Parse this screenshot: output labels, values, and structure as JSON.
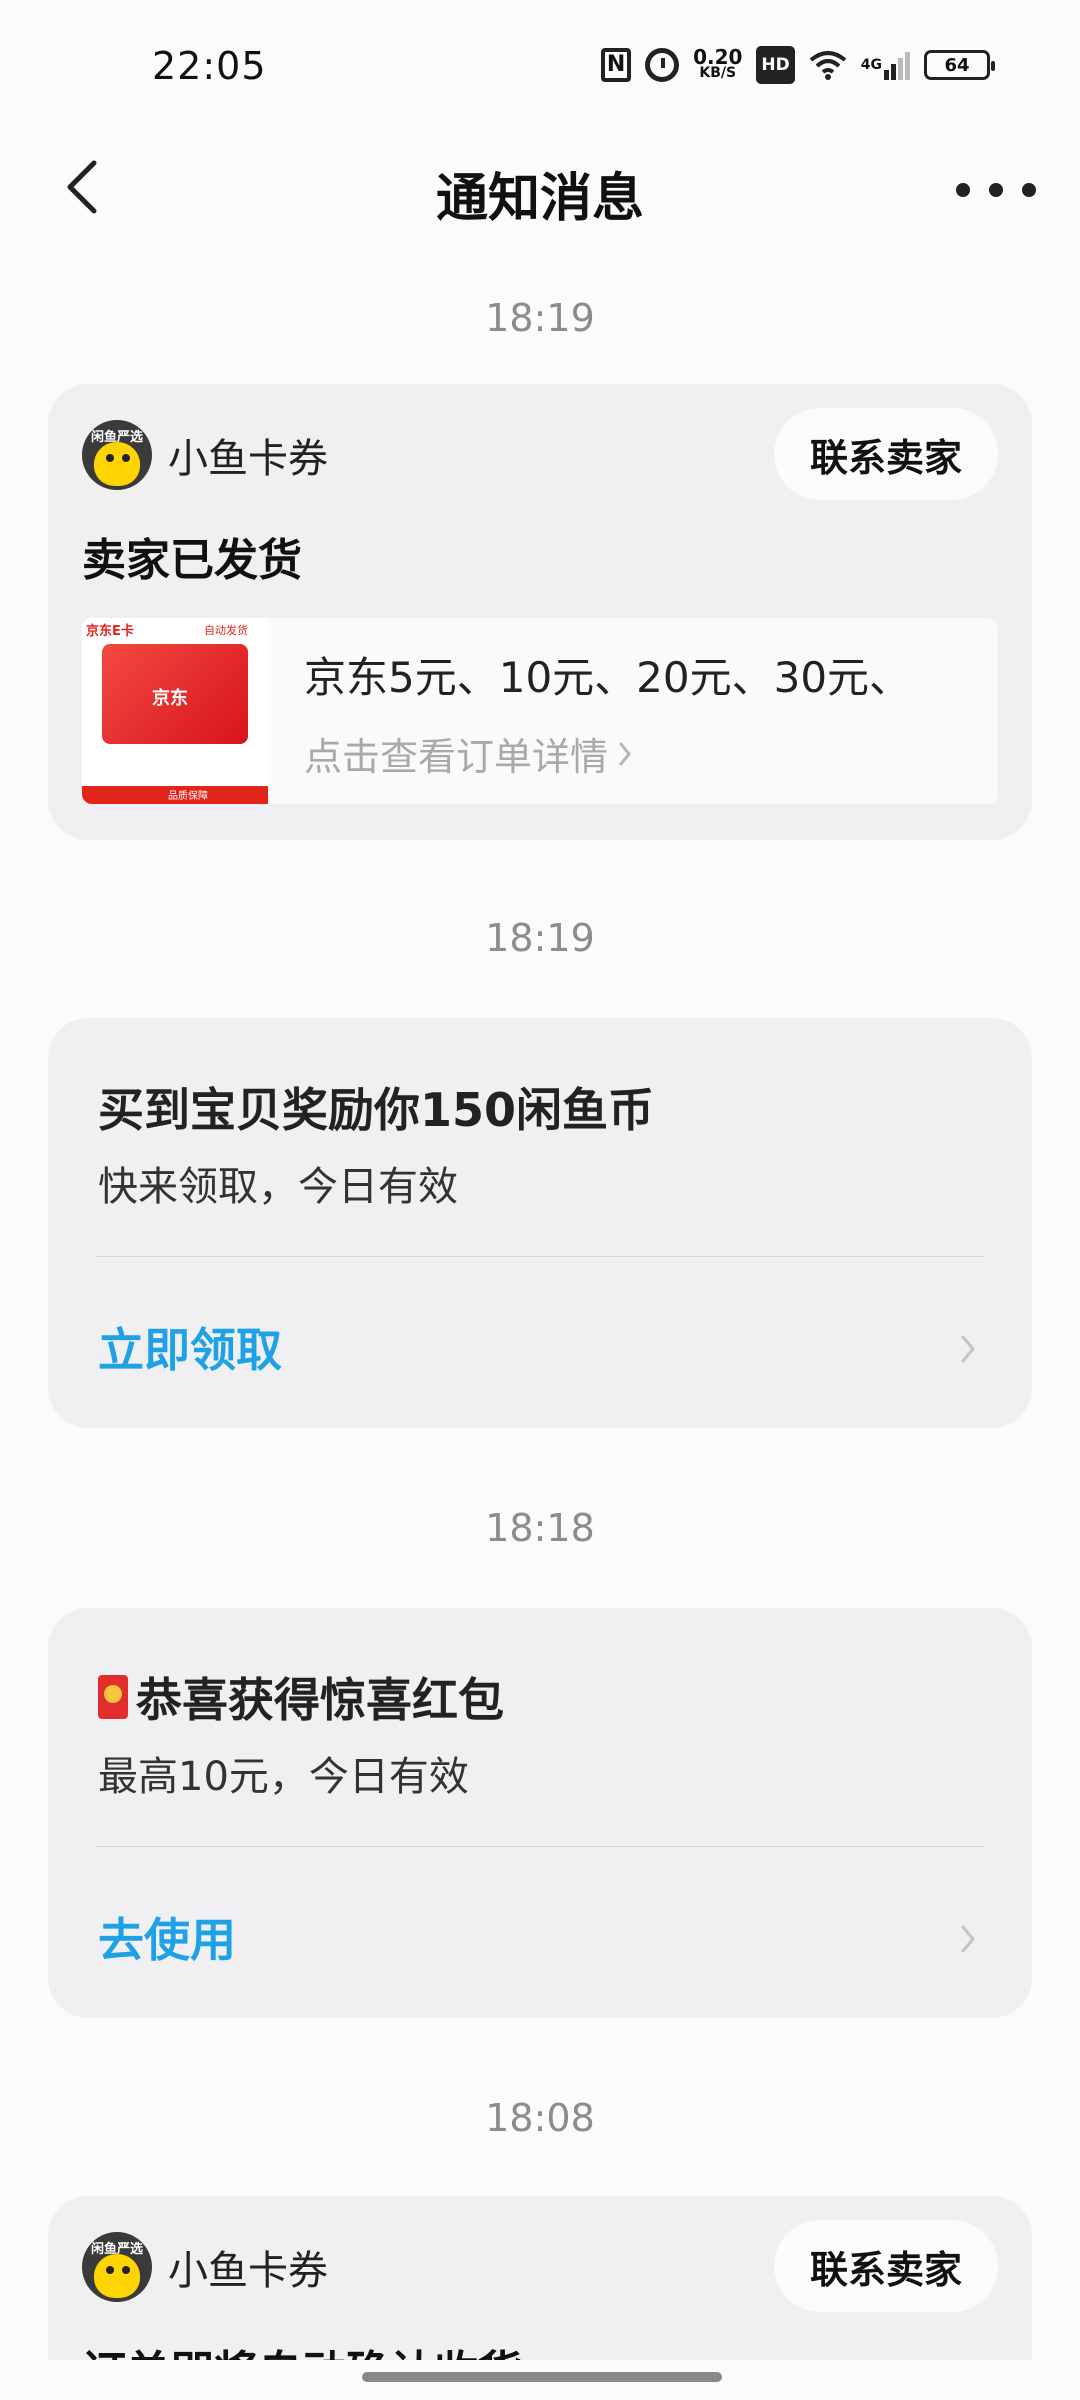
{
  "status_bar": {
    "time": "22:05",
    "nfc": "N",
    "net_speed_value": "0.20",
    "net_speed_unit": "KB/S",
    "hd": "HD",
    "network": "4G",
    "battery": "64"
  },
  "nav": {
    "title": "通知消息"
  },
  "messages": [
    {
      "time": "18:19",
      "seller": "小鱼卡券",
      "avatar_tag": "闲鱼严选",
      "contact": "联系卖家",
      "headline": "卖家已发货",
      "thumb_brand": "京东E卡",
      "thumb_auto": "自动发货",
      "thumb_jd": "京东",
      "thumb_quality": "品质保障",
      "order_title": "京东5元、10元、20元、30元、",
      "order_link": "点击查看订单详情"
    },
    {
      "time": "18:19",
      "title": "买到宝贝奖励你150闲鱼币",
      "subtitle": "快来领取，今日有效",
      "action": "立即领取"
    },
    {
      "time": "18:18",
      "title": "恭喜获得惊喜红包",
      "subtitle": "最高10元，今日有效",
      "action": "去使用"
    },
    {
      "time": "18:08",
      "seller": "小鱼卡券",
      "avatar_tag": "闲鱼严选",
      "contact": "联系卖家",
      "headline": "订单即将自动确认收货"
    }
  ],
  "colors": {
    "accent": "#1fa1e6",
    "card_bg": "#f0f0f2",
    "page_bg": "#fbfbfc",
    "timestamp": "#8c8c8c"
  }
}
